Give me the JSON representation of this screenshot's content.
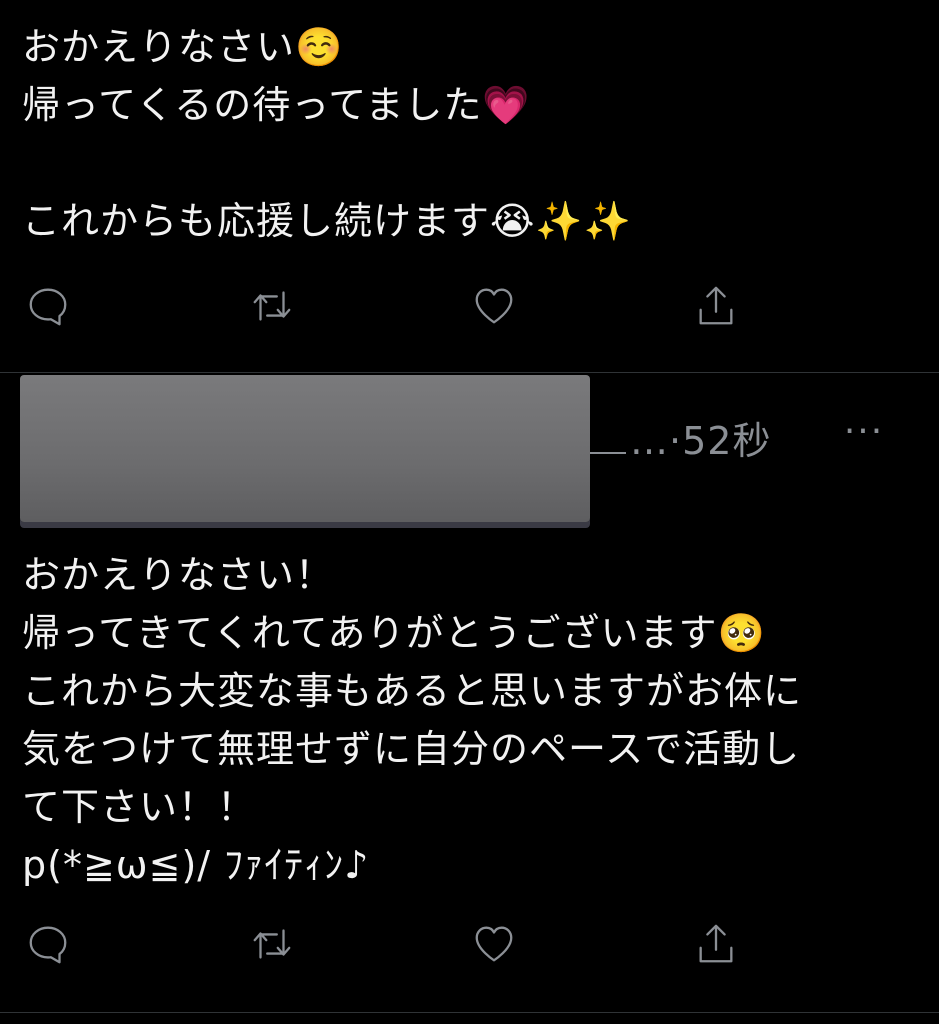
{
  "tweets": [
    {
      "text": "おかえりなさい☺️\n帰ってくるの待ってました💗\n\nこれからも応援し続けます😭✨✨"
    },
    {
      "username": "",
      "separator": "…",
      "dot": "·",
      "time": "52秒",
      "more": "···",
      "text": "おかえりなさい！\n帰ってきてくれてありがとうございます🥺\nこれから大変な事もあると思いますがお体に\n気をつけて無理せずに自分のペースで活動し\nて下さい！！\np(*≧ω≦)/ ﾌｧｲﾃｨﾝ♪"
    }
  ],
  "actions": {
    "reply": "reply-icon",
    "retweet": "retweet-icon",
    "like": "heart-icon",
    "share": "share-icon"
  },
  "colors": {
    "background": "#000000",
    "text": "#f2f2f2",
    "muted": "#8b8f95",
    "divider": "#2f3336"
  }
}
